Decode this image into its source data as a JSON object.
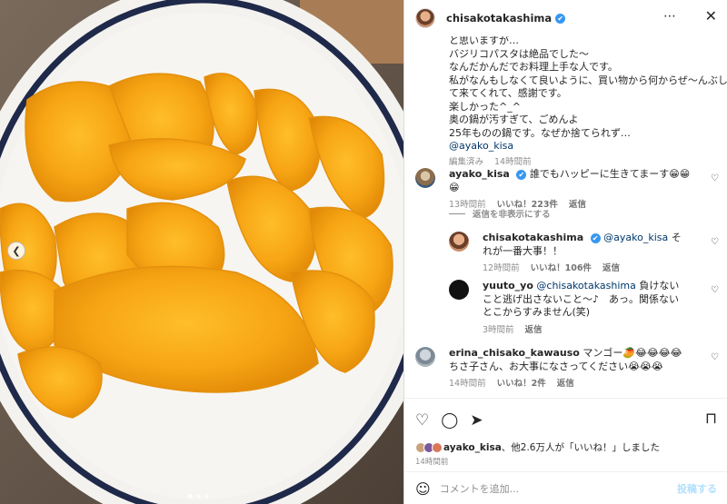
{
  "header": {
    "username": "chisakotakashima",
    "verified": "✔",
    "more_icon": "⋯",
    "close_icon": "✕"
  },
  "photo": {
    "dots": [
      true,
      false,
      false
    ]
  },
  "caption": {
    "lines": [
      "と思いますが…",
      "バジリコパスタは絶品でした〜",
      "なんだかんだでお料理上手な人です。",
      "私がなんもしなくて良いように、買い物から何からぜ〜んぶし",
      "て来てくれて、感謝です。",
      "楽しかった^_^",
      "奥の鍋が汚すぎて、ごめんよ",
      "25年ものの鍋です。なぜか捨てられず…"
    ],
    "mention": "@ayako_kisa",
    "meta": [
      "編集済み",
      "14時間前"
    ]
  },
  "comments": [
    {
      "user": "ayako_kisa",
      "verified": "✔",
      "text": "誰でもハッピーに生きてまーす😁😁😁",
      "meta": {
        "time": "13時間前",
        "likes": "いいね！223件",
        "reply": "返信"
      }
    },
    {
      "user": "chisakotakashima",
      "verified": "✔",
      "mention": "@ayako_kisa",
      "text": "それが一番大事！！",
      "meta": {
        "time": "12時間前",
        "likes": "いいね！106件",
        "reply": "返信"
      }
    },
    {
      "user": "yuuto_yo",
      "mention": "@chisakotakashima",
      "text": "負けないこと逃げ出さないこと〜♪　あっ。関係ないとこからすみません(笑)",
      "meta": {
        "time": "3時間前",
        "reply": "返信"
      }
    },
    {
      "user": "erina_chisako_kawauso",
      "text": "マンゴー🥭😂😂😂😂",
      "text2": "ちさ子さん、お大事になさってください😭😭😭",
      "meta": {
        "time": "14時間前",
        "likes": "いいね！2件",
        "reply": "返信"
      }
    }
  ],
  "hide_replies": "返信を非表示にする",
  "actions": {
    "heart_icon": "♡",
    "comment_icon": "◯",
    "share_icon": "➤",
    "save_icon": "⊓"
  },
  "likes": {
    "user": "ayako_kisa",
    "rest": "、他2.6万人が「いいね！」しました"
  },
  "posted": "14時間前",
  "add_comment": {
    "smile_icon": "☺",
    "placeholder": "コメントを追加...",
    "post_label": "投稿する"
  }
}
